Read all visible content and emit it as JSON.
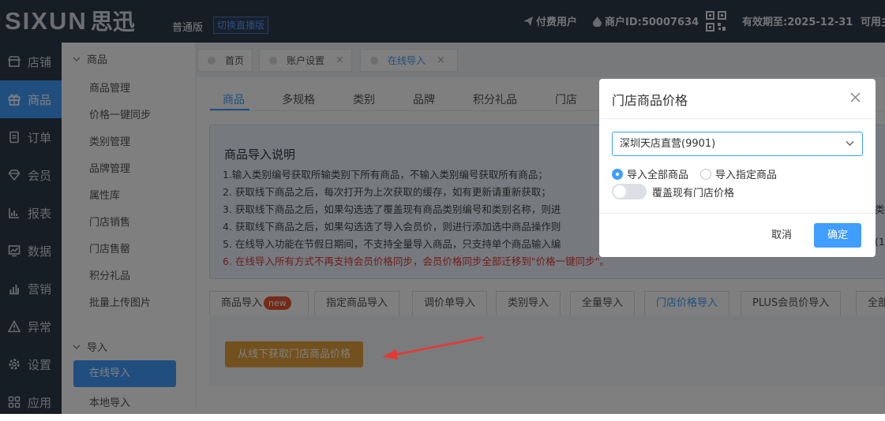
{
  "header": {
    "logo_en": "SIXUN",
    "logo_cn": "思迅",
    "edition": "普通版",
    "switch_label": "切换直播版",
    "paid_user": "付费用户",
    "merchant_id": "商户ID:50007634",
    "expiry": "有效期至:2025-12-31",
    "available": "可用主"
  },
  "sidebar": {
    "items": [
      {
        "label": "店铺",
        "icon": "store-icon"
      },
      {
        "label": "商品",
        "icon": "gift-icon"
      },
      {
        "label": "订单",
        "icon": "order-icon"
      },
      {
        "label": "会员",
        "icon": "member-icon"
      },
      {
        "label": "报表",
        "icon": "report-icon"
      },
      {
        "label": "数据",
        "icon": "data-icon"
      },
      {
        "label": "营销",
        "icon": "marketing-icon"
      },
      {
        "label": "异常",
        "icon": "warning-icon"
      },
      {
        "label": "设置",
        "icon": "gear-icon"
      },
      {
        "label": "应用",
        "icon": "apps-icon"
      }
    ]
  },
  "subnav": {
    "group_goods": "商品",
    "goods_items": [
      "商品管理",
      "价格一键同步",
      "类别管理",
      "品牌管理",
      "属性库",
      "门店销售",
      "门店售罄",
      "积分礼品",
      "批量上传图片"
    ],
    "group_import": "导入",
    "import_items": [
      "在线导入",
      "本地导入"
    ]
  },
  "page_tabs": [
    {
      "label": "首页"
    },
    {
      "label": "账户设置",
      "close": "×"
    },
    {
      "label": "在线导入",
      "close": "×"
    }
  ],
  "content_tabs": [
    "商品",
    "多规格",
    "类别",
    "品牌",
    "积分礼品",
    "门店"
  ],
  "notice": {
    "title": "商品导入说明",
    "lines": [
      "1.输入类别编号获取所输类别下所有商品，不输入类别编号获取所有商品；",
      "2. 获取线下商品之后，每次打开为上次获取的缓存，如有更新请重新获取；",
      "3. 获取线下商品之后，如果勾选选了覆盖现有商品类别编号和类别名称，则进",
      "4. 获取线下商品之后，如果勾选选了导入会员价，则进行添加选中商品操作则",
      "5. 在线导入功能在节假日期间，不支持全量导入商品，只支持单个商品输入编",
      "6. 在线导入所有方式不再支持会员价格同步，会员价格同步全部迁移到\"价格一键同步\"。"
    ],
    "overflow_right_3": "类",
    "overflow_right_5": "(1"
  },
  "import_tabs": [
    {
      "label": "商品导入",
      "badge": "new"
    },
    {
      "label": "指定商品导入"
    },
    {
      "label": "调价单导入"
    },
    {
      "label": "类别导入"
    },
    {
      "label": "全量导入"
    },
    {
      "label": "门店价格导入"
    },
    {
      "label": "PLUS会员价导入"
    },
    {
      "label": "全部"
    }
  ],
  "fetch_button": "从线下获取门店商品价格",
  "dialog": {
    "title": "门店商品价格",
    "store_value": "深圳天店直营(9901)",
    "radio_all": "导入全部商品",
    "radio_specific": "导入指定商品",
    "toggle_label": "覆盖现有门店价格",
    "cancel": "取消",
    "ok": "确定"
  },
  "colors": {
    "primary": "#409eff",
    "sidebar_bg": "#2d3a4b",
    "warning_btn": "#e6a23c",
    "notice_red": "#e53935",
    "annotation_arrow": "#e53935"
  }
}
